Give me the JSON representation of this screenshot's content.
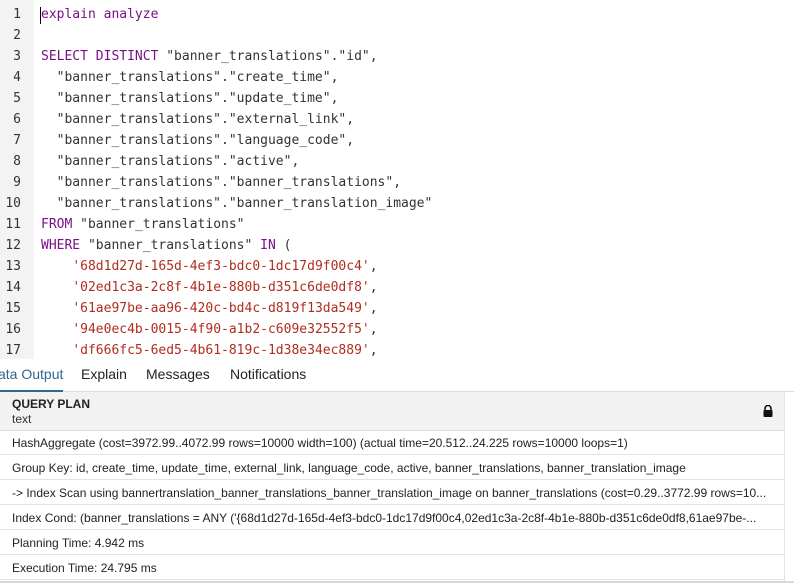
{
  "editor": {
    "lines": [
      {
        "n": "1",
        "parts": [
          {
            "t": "explain analyze",
            "c": "kw"
          }
        ]
      },
      {
        "n": "2",
        "parts": []
      },
      {
        "n": "3",
        "parts": [
          {
            "t": "SELECT DISTINCT ",
            "c": "kw"
          },
          {
            "t": "\"banner_translations\".\"id\",",
            "c": ""
          }
        ]
      },
      {
        "n": "4",
        "parts": [
          {
            "t": "  \"banner_translations\".\"create_time\",",
            "c": ""
          }
        ]
      },
      {
        "n": "5",
        "parts": [
          {
            "t": "  \"banner_translations\".\"update_time\",",
            "c": ""
          }
        ]
      },
      {
        "n": "6",
        "parts": [
          {
            "t": "  \"banner_translations\".\"external_link\",",
            "c": ""
          }
        ]
      },
      {
        "n": "7",
        "parts": [
          {
            "t": "  \"banner_translations\".\"language_code\",",
            "c": ""
          }
        ]
      },
      {
        "n": "8",
        "parts": [
          {
            "t": "  \"banner_translations\".\"active\",",
            "c": ""
          }
        ]
      },
      {
        "n": "9",
        "parts": [
          {
            "t": "  \"banner_translations\".\"banner_translations\",",
            "c": ""
          }
        ]
      },
      {
        "n": "10",
        "parts": [
          {
            "t": "  \"banner_translations\".\"banner_translation_image\"",
            "c": ""
          }
        ]
      },
      {
        "n": "11",
        "parts": [
          {
            "t": "FROM ",
            "c": "kw"
          },
          {
            "t": "\"banner_translations\"",
            "c": ""
          }
        ]
      },
      {
        "n": "12",
        "parts": [
          {
            "t": "WHERE ",
            "c": "kw"
          },
          {
            "t": "\"banner_translations\" ",
            "c": ""
          },
          {
            "t": "IN",
            "c": "kw"
          },
          {
            "t": " (",
            "c": ""
          }
        ]
      },
      {
        "n": "13",
        "parts": [
          {
            "t": "    ",
            "c": ""
          },
          {
            "t": "'68d1d27d-165d-4ef3-bdc0-1dc17d9f00c4'",
            "c": "str"
          },
          {
            "t": ",",
            "c": ""
          }
        ]
      },
      {
        "n": "14",
        "parts": [
          {
            "t": "    ",
            "c": ""
          },
          {
            "t": "'02ed1c3a-2c8f-4b1e-880b-d351c6de0df8'",
            "c": "str"
          },
          {
            "t": ",",
            "c": ""
          }
        ]
      },
      {
        "n": "15",
        "parts": [
          {
            "t": "    ",
            "c": ""
          },
          {
            "t": "'61ae97be-aa96-420c-bd4c-d819f13da549'",
            "c": "str"
          },
          {
            "t": ",",
            "c": ""
          }
        ]
      },
      {
        "n": "16",
        "parts": [
          {
            "t": "    ",
            "c": ""
          },
          {
            "t": "'94e0ec4b-0015-4f90-a1b2-c609e32552f5'",
            "c": "str"
          },
          {
            "t": ",",
            "c": ""
          }
        ]
      },
      {
        "n": "17",
        "parts": [
          {
            "t": "    ",
            "c": ""
          },
          {
            "t": "'df666fc5-6ed5-4b61-819c-1d38e34ec889'",
            "c": "str"
          },
          {
            "t": ",",
            "c": ""
          }
        ]
      }
    ]
  },
  "tabs": {
    "data_output": "ata Output",
    "explain": "Explain",
    "messages": "Messages",
    "notifications": "Notifications"
  },
  "grid": {
    "column_name": "QUERY PLAN",
    "column_type": "text",
    "rows": [
      "HashAggregate  (cost=3972.99..4072.99 rows=10000 width=100) (actual time=20.512..24.225 rows=10000 loops=1)",
      "  Group Key: id, create_time, update_time, external_link, language_code, active, banner_translations, banner_translation_image",
      "  ->  Index Scan using bannertranslation_banner_translations_banner_translation_image on banner_translations  (cost=0.29..3772.99 rows=10...",
      "        Index Cond: (banner_translations = ANY ('{68d1d27d-165d-4ef3-bdc0-1dc17d9f00c4,02ed1c3a-2c8f-4b1e-880b-d351c6de0df8,61ae97be-...",
      "Planning Time: 4.942 ms",
      "Execution Time: 24.795 ms"
    ]
  },
  "colors": {
    "keyword": "#7a0f8a",
    "string": "#b02d1f",
    "active_tab": "#326690"
  }
}
